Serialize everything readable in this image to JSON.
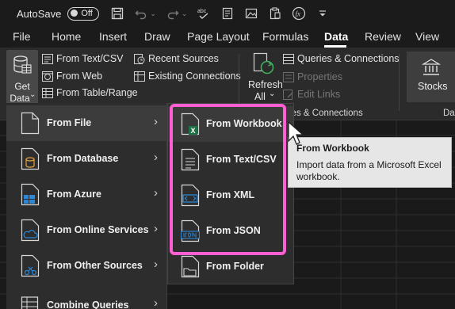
{
  "titlebar": {
    "autosave_label": "AutoSave",
    "autosave_state": "Off",
    "qat_icons": [
      "save-icon",
      "undo-icon",
      "redo-icon",
      "spelling-icon",
      "form-icon",
      "picture-icon",
      "clipboard-icon",
      "function-icon",
      "customize-icon"
    ]
  },
  "tabs": [
    "File",
    "Home",
    "Insert",
    "Draw",
    "Page Layout",
    "Formulas",
    "Data",
    "Review",
    "View"
  ],
  "active_tab": "Data",
  "ribbon": {
    "get_data_line1": "Get",
    "get_data_line2": "Data",
    "get_data_caret": "⌄",
    "from_text_csv": "From Text/CSV",
    "from_web": "From Web",
    "from_table_range": "From Table/Range",
    "recent_sources": "Recent Sources",
    "existing_connections": "Existing Connections",
    "refresh_line1": "Refresh",
    "refresh_line2": "All",
    "refresh_caret": "⌄",
    "queries_connections": "Queries & Connections",
    "properties": "Properties",
    "edit_links": "Edit Links",
    "group_label_queries": "ies & Connections",
    "stocks": "Stocks",
    "group_label_datatypes": "Da"
  },
  "menu_main": [
    {
      "label": "From File",
      "underline_char": "F",
      "icon": "file-icon"
    },
    {
      "label": "From Database",
      "underline_char": "D",
      "icon": "database-icon"
    },
    {
      "label": "From Azure",
      "underline_char": "A",
      "icon": "azure-icon"
    },
    {
      "label": "From Online Services",
      "underline_char": "O",
      "icon": "cloud-icon"
    },
    {
      "label": "From Other Sources",
      "underline_char": "O",
      "icon": "other-sources-icon"
    },
    {
      "label": "Combine Queries",
      "underline_char": "C",
      "icon": "combine-icon"
    }
  ],
  "menu_sub": [
    {
      "label": "From Workbook",
      "icon": "excel-workbook-icon"
    },
    {
      "label": "From Text/CSV",
      "icon": "text-csv-icon"
    },
    {
      "label": "From XML",
      "icon": "xml-icon"
    },
    {
      "label": "From JSON",
      "icon": "json-icon"
    },
    {
      "label": "From Folder",
      "icon": "folder-icon"
    }
  ],
  "tooltip": {
    "title": "From Workbook",
    "body": "Import data from a Microsoft Excel workbook."
  },
  "colors": {
    "annotation": "#ff5fd1",
    "excel_green": "#1e7145",
    "azure_blue": "#2b88d8",
    "database_orange": "#e2a23b"
  }
}
